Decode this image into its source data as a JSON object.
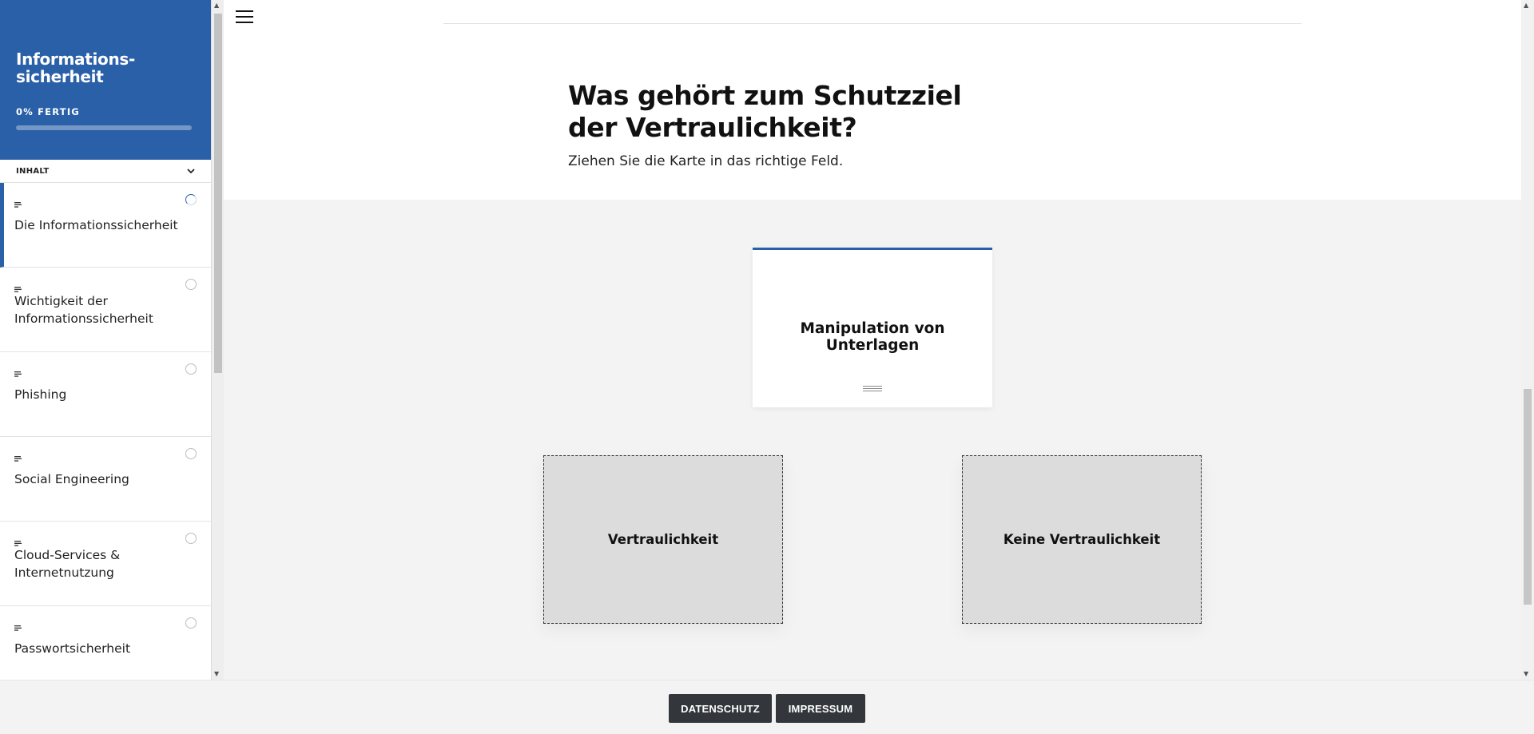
{
  "sidebar": {
    "course_title": "Informations-\nsicherheit",
    "progress_label": "0% FERTIG",
    "progress_value": 0,
    "toc_label": "INHALT",
    "toc_icon": "chevron-down-icon",
    "lessons": [
      {
        "title": "Die Informationssicherheit",
        "status": "in-progress",
        "active": true,
        "icon": "text-lesson-icon"
      },
      {
        "title": "Wichtigkeit der Informationssicherheit",
        "status": "not-started",
        "active": false,
        "icon": "text-lesson-icon"
      },
      {
        "title": "Phishing",
        "status": "not-started",
        "active": false,
        "icon": "text-lesson-icon"
      },
      {
        "title": "Social Engineering",
        "status": "not-started",
        "active": false,
        "icon": "text-lesson-icon"
      },
      {
        "title": "Cloud-Services & Internetnutzung",
        "status": "not-started",
        "active": false,
        "icon": "text-lesson-icon"
      },
      {
        "title": "Passwortsicherheit",
        "status": "not-started",
        "active": false,
        "icon": "text-lesson-icon"
      }
    ]
  },
  "main": {
    "menu_icon": "hamburger-menu-icon",
    "question_title": "Was gehört zum Schutzziel der Vertraulichkeit?",
    "question_hint": "Ziehen Sie die Karte in das richtige Feld.",
    "drag_card": {
      "text": "Manipulation von Unterlagen",
      "handle_icon": "drag-handle-icon"
    },
    "drop_zones": [
      {
        "label": "Vertraulichkeit"
      },
      {
        "label": "Keine Vertraulichkeit"
      }
    ]
  },
  "footer": {
    "datenschutz_label": "DATENSCHUTZ",
    "impressum_label": "IMPRESSUM"
  },
  "colors": {
    "accent": "#2a60a8",
    "footer_button": "#33363b",
    "background": "#f3f3f3"
  }
}
